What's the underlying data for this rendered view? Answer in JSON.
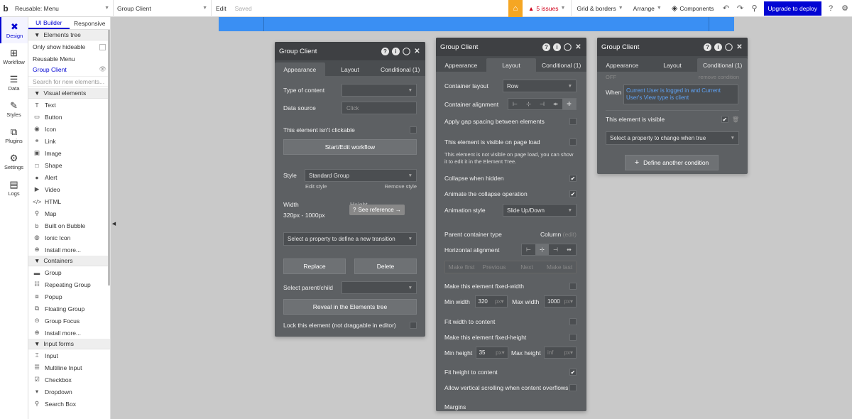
{
  "topbar": {
    "logo": "b",
    "page_select": "Reusable: Menu",
    "element_select": "Group Client",
    "edit_label": "Edit",
    "saved_label": "Saved",
    "issues_label": "5 issues",
    "grid_label": "Grid & borders",
    "arrange_label": "Arrange",
    "components_label": "Components",
    "deploy_label": "Upgrade to deploy",
    "help_label": "?"
  },
  "rail": {
    "items": [
      {
        "label": "Design",
        "icon": "design-icon"
      },
      {
        "label": "Workflow",
        "icon": "workflow-icon"
      },
      {
        "label": "Data",
        "icon": "data-icon"
      },
      {
        "label": "Styles",
        "icon": "styles-icon"
      },
      {
        "label": "Plugins",
        "icon": "plugins-icon"
      },
      {
        "label": "Settings",
        "icon": "gear-icon"
      },
      {
        "label": "Logs",
        "icon": "logs-icon"
      }
    ]
  },
  "elements_panel": {
    "tabs": [
      "UI Builder",
      "Responsive"
    ],
    "tree_header": "Elements tree",
    "only_show_hideable": "Only show hideable",
    "tree_root": "Reusable Menu",
    "tree_child": "Group Client",
    "search_placeholder": "Search for new elements...",
    "visual_header": "Visual elements",
    "visual_items": [
      "Text",
      "Button",
      "Icon",
      "Link",
      "Image",
      "Shape",
      "Alert",
      "Video",
      "HTML",
      "Map",
      "Built on Bubble",
      "Ionic Icon",
      "Install more..."
    ],
    "containers_header": "Containers",
    "container_items": [
      "Group",
      "Repeating Group",
      "Popup",
      "Floating Group",
      "Group Focus",
      "Install more..."
    ],
    "input_header": "Input forms",
    "input_items": [
      "Input",
      "Multiline Input",
      "Checkbox",
      "Dropdown",
      "Search Box"
    ]
  },
  "panel1": {
    "title": "Group Client",
    "tabs": [
      "Appearance",
      "Layout",
      "Conditional (1)"
    ],
    "type_of_content_label": "Type of content",
    "data_source_label": "Data source",
    "data_source_placeholder": "Click",
    "not_clickable_label": "This element isn't clickable",
    "workflow_button": "Start/Edit workflow",
    "style_label": "Style",
    "style_value": "Standard Group",
    "edit_style": "Edit style",
    "remove_style": "Remove style",
    "width_label": "Width",
    "width_value": "320px - 1000px",
    "height_label": "Height",
    "see_reference": "See reference →",
    "transition_select": "Select a property to define a new transition",
    "replace_button": "Replace",
    "delete_button": "Delete",
    "select_parent_label": "Select parent/child",
    "reveal_button": "Reveal in the Elements tree",
    "lock_label": "Lock this element (not draggable in editor)"
  },
  "panel2": {
    "title": "Group Client",
    "tabs": [
      "Appearance",
      "Layout",
      "Conditional (1)"
    ],
    "container_layout_label": "Container layout",
    "container_layout_value": "Row",
    "container_alignment_label": "Container alignment",
    "gap_label": "Apply gap spacing between elements",
    "visible_on_load_label": "This element is visible on page load",
    "visible_note": "This element is not visible on page load, you can show it to edit it in the Element Tree.",
    "collapse_label": "Collapse when hidden",
    "animate_label": "Animate the collapse operation",
    "animation_style_label": "Animation style",
    "animation_style_value": "Slide Up/Down",
    "parent_type_label": "Parent container type",
    "parent_type_value": "Column",
    "parent_type_edit": "(edit)",
    "horizontal_alignment_label": "Horizontal alignment",
    "order_buttons": [
      "Make first",
      "Previous",
      "Next",
      "Make last"
    ],
    "fixed_width_label": "Make this element fixed-width",
    "min_width_label": "Min width",
    "min_width_value": "320",
    "max_width_label": "Max width",
    "max_width_value": "1000",
    "unit": "px",
    "fit_width_label": "Fit width to content",
    "fixed_height_label": "Make this element fixed-height",
    "min_height_label": "Min height",
    "min_height_value": "35",
    "max_height_label": "Max height",
    "max_height_placeholder": "inf",
    "fit_height_label": "Fit height to content",
    "vertical_scroll_label": "Allow vertical scrolling when content overflows",
    "margins_label": "Margins"
  },
  "panel3": {
    "title": "Group Client",
    "tabs": [
      "Appearance",
      "Layout",
      "Conditional (1)"
    ],
    "off_label": "OFF",
    "remove_condition": "remove condition",
    "when_label": "When",
    "condition_text": "Current User is logged in and Current User's View type is client",
    "visible_label": "This element is visible",
    "property_select": "Select a property to change when true",
    "define_button": "Define another condition"
  },
  "colors": {
    "accent": "#0205d3",
    "canvas_bar": "#3a8ff3",
    "panel_bg": "#5d6063",
    "panel_header": "#3e4043",
    "issues": "#d0021b",
    "bulb": "#f5a623"
  }
}
